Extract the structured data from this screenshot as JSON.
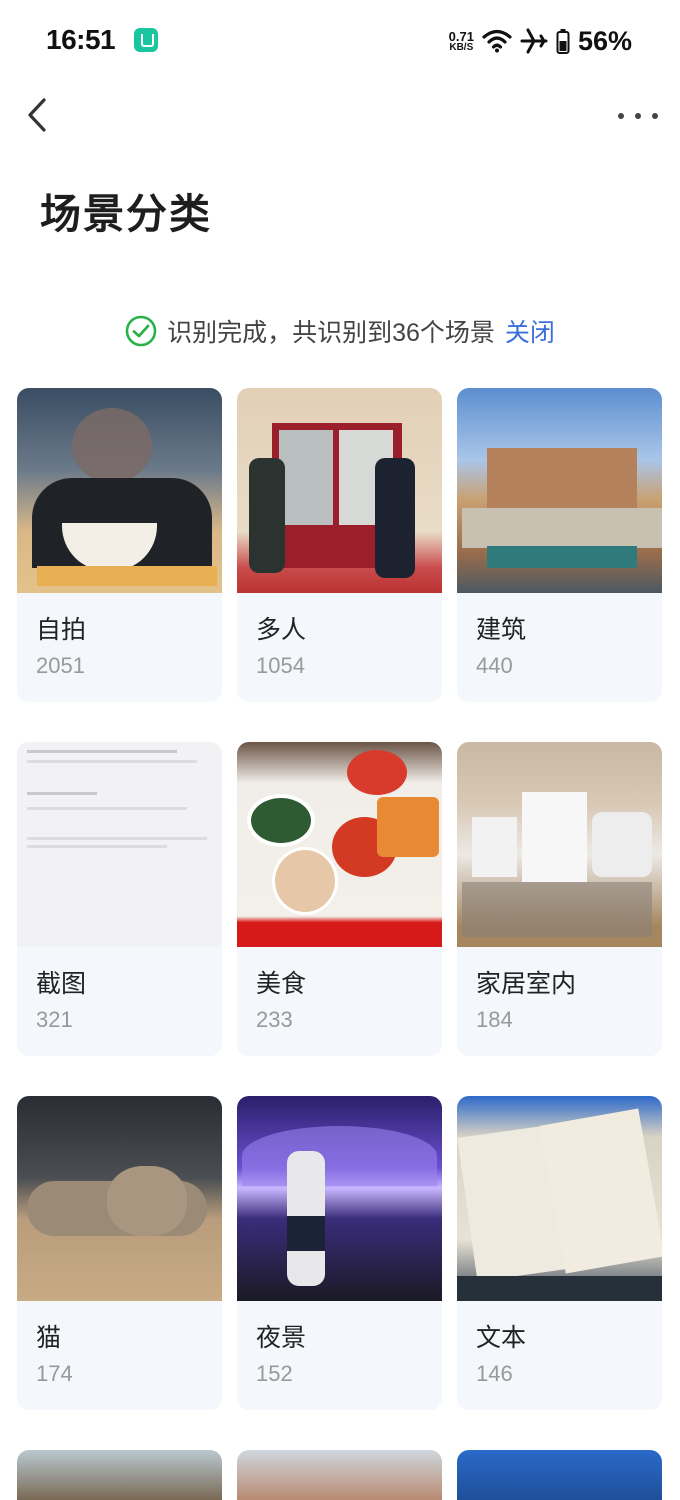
{
  "status": {
    "time": "16:51",
    "speed_value": "0.71",
    "speed_unit": "KB/S",
    "battery": "56%"
  },
  "nav": {
    "back_icon": "chevron-left-icon",
    "more_icon": "more-horizontal-icon"
  },
  "page_title": "场景分类",
  "banner": {
    "text": "识别完成，共识别到36个场景",
    "close_label": "关闭",
    "accent": "#3b6fd9",
    "check_color": "#2ab24a"
  },
  "scenes": [
    {
      "name": "自拍",
      "count": "2051"
    },
    {
      "name": "多人",
      "count": "1054"
    },
    {
      "name": "建筑",
      "count": "440"
    },
    {
      "name": "截图",
      "count": "321"
    },
    {
      "name": "美食",
      "count": "233"
    },
    {
      "name": "家居室内",
      "count": "184"
    },
    {
      "name": "猫",
      "count": "174"
    },
    {
      "name": "夜景",
      "count": "152"
    },
    {
      "name": "文本",
      "count": "146"
    }
  ]
}
